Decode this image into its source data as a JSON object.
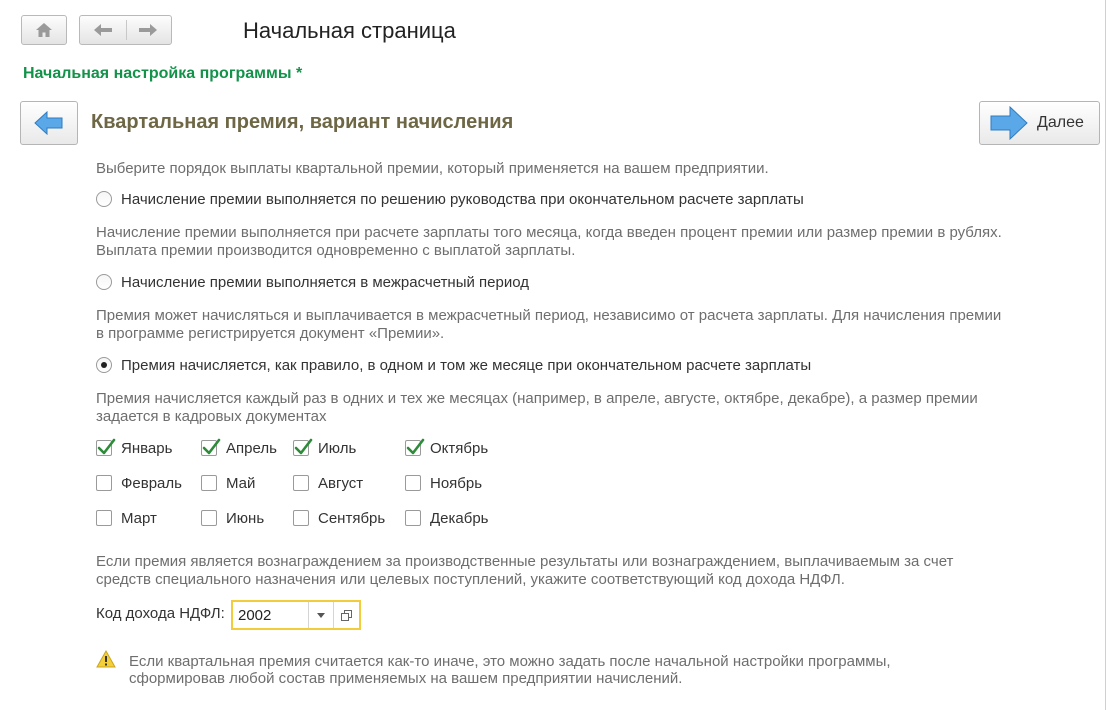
{
  "header": {
    "page_title": "Начальная страница",
    "subtitle": "Начальная настройка программы *"
  },
  "wizard": {
    "section_title": "Квартальная премия,  вариант начисления",
    "next_label": "Далее",
    "intro": "Выберите порядок выплаты квартальной премии, который применяется на вашем предприятии.",
    "options": [
      {
        "label": "Начисление премии выполняется по решению руководства при окончательном расчете зарплаты",
        "selected": false,
        "desc_lines": [
          "Начисление премии выполняется при расчете зарплаты того месяца, когда введен процент премии или размер премии в рублях.",
          "Выплата премии производится одновременно с выплатой зарплаты."
        ]
      },
      {
        "label": "Начисление премии выполняется в межрасчетный период",
        "selected": false,
        "desc_lines": [
          "Премия может начисляться и выплачивается в межрасчетный период, независимо от расчета зарплаты. Для начисления премии",
          "в программе регистрируется документ «Премии»."
        ]
      },
      {
        "label": "Премия начисляется, как правило, в одном и том же месяце при окончательном расчете зарплаты",
        "selected": true,
        "desc_lines": [
          "Премия начисляется каждый раз в одних и тех же месяцах (например, в апреле, августе, октябре, декабре), а размер премии",
          "задается в кадровых документах"
        ]
      }
    ],
    "months": [
      {
        "label": "Январь",
        "checked": true
      },
      {
        "label": "Апрель",
        "checked": true
      },
      {
        "label": "Июль",
        "checked": true
      },
      {
        "label": "Октябрь",
        "checked": true
      },
      {
        "label": "Февраль",
        "checked": false
      },
      {
        "label": "Май",
        "checked": false
      },
      {
        "label": "Август",
        "checked": false
      },
      {
        "label": "Ноябрь",
        "checked": false
      },
      {
        "label": "Март",
        "checked": false
      },
      {
        "label": "Июнь",
        "checked": false
      },
      {
        "label": "Сентябрь",
        "checked": false
      },
      {
        "label": "Декабрь",
        "checked": false
      }
    ],
    "ndfl_note_lines": [
      "Если премия является вознаграждением за производственные результаты или вознаграждением, выплачиваемым за счет",
      "средств специального назначения или целевых поступлений, укажите соответствующий код дохода НДФЛ."
    ],
    "ndfl_label": "Код дохода НДФЛ:",
    "ndfl_value": "2002",
    "warning_lines": [
      "Если квартальная премия считается как-то иначе, это можно задать после начальной настройки программы,",
      "сформировав любой состав применяемых на вашем предприятии начислений."
    ]
  },
  "colors": {
    "subtitle_green": "#13924a",
    "section_title": "#6e6745",
    "focus_border": "#f3cc3c",
    "arrow_blue": "#3d8fd6",
    "check_green": "#2e8b3a"
  }
}
